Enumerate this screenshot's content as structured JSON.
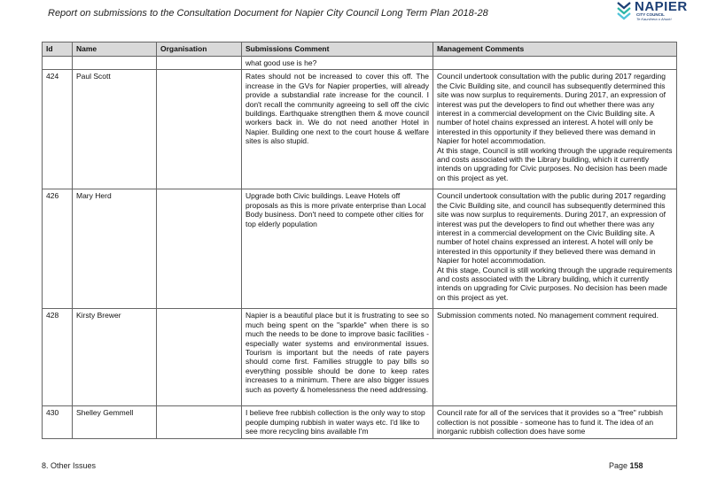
{
  "header": {
    "title": "Report on submissions to the Consultation Document for Napier City Council Long Term Plan 2018-28",
    "logo": {
      "name": "NAPIER",
      "sub": "CITY COUNCIL",
      "sub2": "Te Kaunihera o Ahuriri"
    }
  },
  "table": {
    "columns": [
      "Id",
      "Name",
      "Organisation",
      "Submissions Comment",
      "Management Comments"
    ],
    "continued_row": {
      "comment": "what good use is he?"
    },
    "rows": [
      {
        "id": "424",
        "name": "Paul Scott",
        "organisation": "",
        "comment": "Rates should not be increased to cover this off. The increase in the GVs for Napier properties, will already provide a substandial rate increase for the council. I don't recall the community agreeing to sell off the civic buildings. Earthquake strengthen them & move council workers back in. We do not need another Hotel in Napier. Building one next to the court house & welfare sites is also stupid.",
        "management": [
          "Council undertook consultation with the public during 2017 regarding the Civic Building site, and council has subsequently determined this site was now surplus to requirements. During 2017, an expression of interest was put the developers to find out whether there was any interest in a commercial development on the Civic Building site. A number of hotel chains expressed an interest. A hotel will only be interested in this opportunity if they believed there was demand in Napier for hotel accommodation.",
          "At this stage, Council is still working through the upgrade requirements and costs associated with the Library building, which it currently intends on upgrading for Civic purposes. No decision has been made on this project as yet."
        ]
      },
      {
        "id": "426",
        "name": "Mary Herd",
        "organisation": "",
        "comment": "Upgrade both Civic buildings. Leave Hotels off proposals as this is more private enterprise than Local Body business. Don't need to compete other cities for top elderly population",
        "management": [
          "Council undertook consultation with the public during 2017 regarding the Civic Building site, and council has subsequently determined this site was now surplus to requirements. During 2017, an expression of interest was put the developers to find out whether there was any interest in a commercial development on the Civic Building site. A number of hotel chains expressed an interest. A hotel will only be interested in this opportunity if they believed there was demand in Napier for hotel accommodation.",
          "At this stage, Council is still working through the upgrade requirements and costs associated with the Library building, which it currently intends on upgrading for Civic purposes. No decision has been made on this project as yet."
        ]
      },
      {
        "id": "428",
        "name": "Kirsty Brewer",
        "organisation": "",
        "comment": "Napier is a beautiful place but it is frustrating to see so much being spent on the \"sparkle\" when there is so much the needs to be done to improve basic facilities - especially water systems and environmental issues. Tourism is important but the needs of rate payers should come first. Families struggle to pay bills so everything possible should be done to keep rates increases to a minimum. There are also bigger issues such as poverty & homelessness the need addressing.",
        "management": [
          "Submission comments noted. No management comment required."
        ]
      },
      {
        "id": "430",
        "name": "Shelley Gemmell",
        "organisation": "",
        "comment": "I believe free rubbish collection is the only way to stop people dumping rubbish in water ways etc. I'd like to see more recycling bins available I'm",
        "management": [
          "Council rate for all of the services that it provides so a \"free\" rubbish collection is not possible - someone has to fund it. The idea of an inorganic rubbish collection does have some"
        ]
      }
    ]
  },
  "footer": {
    "section": "8. Other Issues",
    "page_label": "Page",
    "page_number": "158"
  }
}
